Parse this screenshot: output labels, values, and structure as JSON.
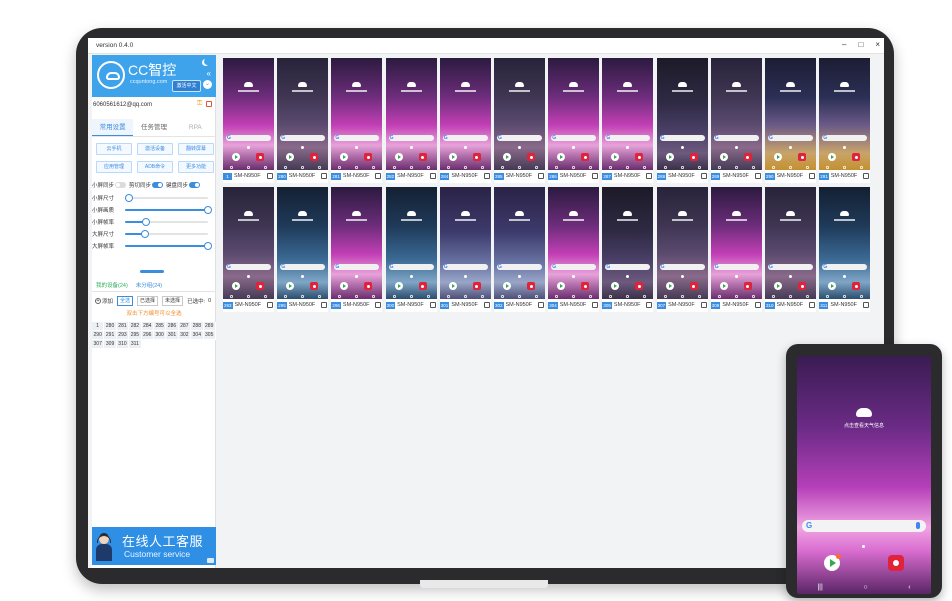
{
  "window": {
    "title": "version 0.4.0",
    "controls": [
      "–",
      "□",
      "×"
    ]
  },
  "sidebar": {
    "brand": {
      "name": "CC智控",
      "url": "ccquntong.com"
    },
    "switch_button": "激活中文",
    "account": "6060561612@qq.com",
    "tabs": [
      "常用设置",
      "任务管理",
      "RPA"
    ],
    "buttons": [
      "云手机",
      "激活设备",
      "翻转屏幕",
      "应用管理",
      "ADB命令",
      "更多功能"
    ],
    "toggles": [
      {
        "label": "小屏同步",
        "on": false
      },
      {
        "label": "剪切同步",
        "on": true
      },
      {
        "label": "键盘同步",
        "on": true
      }
    ],
    "sliders": [
      {
        "label": "小屏尺寸",
        "value": 0.05
      },
      {
        "label": "小屏画质",
        "value": 1.0
      },
      {
        "label": "小屏帧率",
        "value": 0.25
      },
      {
        "label": "大屏尺寸",
        "value": 0.24
      },
      {
        "label": "大屏帧率",
        "value": 1.0
      }
    ],
    "device_tabs": {
      "mine": "我的设备(24)",
      "other": "未分组(24)"
    },
    "filter": {
      "add": "添加",
      "all": "全选",
      "selected": "已选择",
      "unselected": "未选择",
      "count_label": "已选中:",
      "count": "0"
    },
    "hint": "双击下方编号可以全选",
    "numbers": [
      "1",
      "280",
      "281",
      "282",
      "284",
      "285",
      "286",
      "287",
      "288",
      "289",
      "290",
      "291",
      "293",
      "295",
      "296",
      "300",
      "301",
      "302",
      "304",
      "305",
      "307",
      "309",
      "310",
      "311"
    ],
    "service": {
      "cn": "在线人工客服",
      "en": "Customer service"
    }
  },
  "devices": [
    {
      "num": "1",
      "model": "SM-N950F",
      "bg": "a"
    },
    {
      "num": "280",
      "model": "SM-N950F",
      "bg": "b"
    },
    {
      "num": "281",
      "model": "SM-N950F",
      "bg": "a"
    },
    {
      "num": "282",
      "model": "SM-N950F",
      "bg": "a"
    },
    {
      "num": "284",
      "model": "SM-N950F",
      "bg": "a"
    },
    {
      "num": "285",
      "model": "SM-N950F",
      "bg": "b"
    },
    {
      "num": "286",
      "model": "SM-N950F",
      "bg": "a"
    },
    {
      "num": "287",
      "model": "SM-N950F",
      "bg": "a"
    },
    {
      "num": "288",
      "model": "SM-N950F",
      "bg": "f"
    },
    {
      "num": "289",
      "model": "SM-N950F",
      "bg": "b"
    },
    {
      "num": "290",
      "model": "SM-N950F",
      "bg": "c"
    },
    {
      "num": "291",
      "model": "SM-N950F",
      "bg": "c"
    },
    {
      "num": "293",
      "model": "SM-N950F",
      "bg": "b"
    },
    {
      "num": "295",
      "model": "SM-N950F",
      "bg": "d"
    },
    {
      "num": "296",
      "model": "SM-N950F",
      "bg": "a"
    },
    {
      "num": "300",
      "model": "SM-N950F",
      "bg": "d"
    },
    {
      "num": "301",
      "model": "SM-N950F",
      "bg": "e"
    },
    {
      "num": "302",
      "model": "SM-N950F",
      "bg": "e"
    },
    {
      "num": "304",
      "model": "SM-N950F",
      "bg": "a"
    },
    {
      "num": "305",
      "model": "SM-N950F",
      "bg": "f"
    },
    {
      "num": "307",
      "model": "SM-N950F",
      "bg": "b"
    },
    {
      "num": "309",
      "model": "SM-N950F",
      "bg": "a"
    },
    {
      "num": "310",
      "model": "SM-N950F",
      "bg": "b"
    },
    {
      "num": "311",
      "model": "SM-N950F",
      "bg": "d"
    }
  ],
  "phone": {
    "status": "点击查看天气信息",
    "nav": [
      "|||",
      "○",
      "‹"
    ]
  }
}
